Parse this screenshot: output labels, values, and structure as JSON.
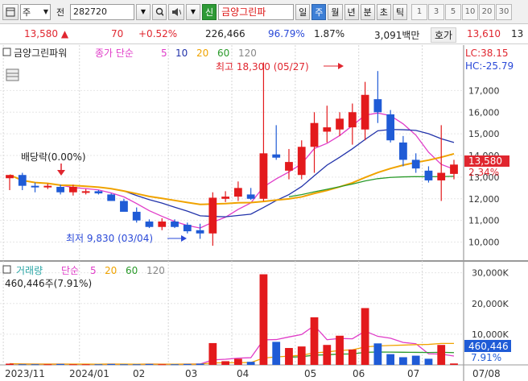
{
  "toolbar": {
    "layout_icon": "window-icon",
    "type_value": "주",
    "field_label": "전",
    "code": "282720",
    "sound_icon": "speaker-icon",
    "credit_label": "신",
    "stock_name": "금양그린파",
    "periods": [
      "일",
      "주",
      "월",
      "년",
      "분",
      "초",
      "틱"
    ],
    "active_period": "주",
    "intervals": [
      "1",
      "3",
      "5",
      "10",
      "20",
      "30"
    ]
  },
  "info": {
    "price": "13,580",
    "change": "70",
    "change_pct": "+0.52%",
    "volume": "226,466",
    "vol_ratio": "96.79%",
    "turnover": "1.87%",
    "amount": "3,091백만",
    "ask_label": "호가",
    "ask_price": "13,610",
    "last": "13"
  },
  "price_panel": {
    "title": "금양그린파워",
    "ma_label": "종가 단순",
    "ma_periods": [
      "5",
      "10",
      "20",
      "60",
      "120"
    ],
    "lc": "LC:38.15",
    "hc": "HC:-25.79",
    "high_note": "최고 18,300 (05/27)",
    "low_note": "최저 9,830 (03/04)",
    "dividend_note": "배당락(0.00%)",
    "current_price": "13,580",
    "current_pct": "2.34%",
    "y_ticks": [
      "17,000",
      "16,000",
      "15,000",
      "14,000",
      "13,000",
      "12,000",
      "11,000",
      "10,000"
    ]
  },
  "volume_panel": {
    "title": "거래량",
    "ma_label": "단순",
    "ma_periods": [
      "5",
      "20",
      "60",
      "120"
    ],
    "volume_note": "460,446주(7.91%)",
    "current_volume": "460,446",
    "current_pct": "7.91%",
    "y_ticks": [
      "30,000K",
      "20,000K",
      "10,000K"
    ]
  },
  "x_axis": [
    "2023/11",
    "2024/01",
    "02",
    "03",
    "04",
    "05",
    "06",
    "07",
    "07/08"
  ],
  "colors": {
    "up": "#e31a1c",
    "down": "#1f5bd6",
    "ma5": "#e03cc8",
    "ma10": "#2233aa",
    "ma20": "#f0a300",
    "ma60": "#2a9a2a"
  },
  "chart_data": {
    "type": "candlestick",
    "candles": [
      {
        "o": 12950,
        "h": 13100,
        "l": 12400,
        "c": 13100
      },
      {
        "o": 13100,
        "h": 13200,
        "l": 12400,
        "c": 12600
      },
      {
        "o": 12600,
        "h": 12750,
        "l": 12300,
        "c": 12550
      },
      {
        "o": 12550,
        "h": 12700,
        "l": 12450,
        "c": 12600
      },
      {
        "o": 12550,
        "h": 12650,
        "l": 12200,
        "c": 12300
      },
      {
        "o": 12300,
        "h": 12650,
        "l": 12150,
        "c": 12550
      },
      {
        "o": 12300,
        "h": 12450,
        "l": 12200,
        "c": 12350
      },
      {
        "o": 12350,
        "h": 12400,
        "l": 12200,
        "c": 12250
      },
      {
        "o": 12200,
        "h": 12250,
        "l": 11900,
        "c": 11900
      },
      {
        "o": 11900,
        "h": 12000,
        "l": 11500,
        "c": 11400
      },
      {
        "o": 11400,
        "h": 11600,
        "l": 10900,
        "c": 11000
      },
      {
        "o": 10950,
        "h": 11050,
        "l": 10650,
        "c": 10700
      },
      {
        "o": 10700,
        "h": 11100,
        "l": 10550,
        "c": 10950
      },
      {
        "o": 10950,
        "h": 11050,
        "l": 10650,
        "c": 10700
      },
      {
        "o": 10800,
        "h": 10900,
        "l": 10400,
        "c": 10500
      },
      {
        "o": 10550,
        "h": 10850,
        "l": 10150,
        "c": 10400
      },
      {
        "o": 10400,
        "h": 12300,
        "l": 9830,
        "c": 12050
      },
      {
        "o": 12000,
        "h": 12350,
        "l": 11850,
        "c": 12100
      },
      {
        "o": 12100,
        "h": 12800,
        "l": 11900,
        "c": 12500
      },
      {
        "o": 12200,
        "h": 12500,
        "l": 11950,
        "c": 12000
      },
      {
        "o": 12000,
        "h": 18300,
        "l": 11900,
        "c": 14100
      },
      {
        "o": 14050,
        "h": 15400,
        "l": 13800,
        "c": 13900
      },
      {
        "o": 13300,
        "h": 14300,
        "l": 12900,
        "c": 13700
      },
      {
        "o": 13100,
        "h": 14700,
        "l": 12900,
        "c": 14400
      },
      {
        "o": 14400,
        "h": 16000,
        "l": 13200,
        "c": 15500
      },
      {
        "o": 15100,
        "h": 16300,
        "l": 14600,
        "c": 15300
      },
      {
        "o": 15200,
        "h": 16000,
        "l": 14900,
        "c": 15700
      },
      {
        "o": 15300,
        "h": 16400,
        "l": 14500,
        "c": 16000
      },
      {
        "o": 15200,
        "h": 17400,
        "l": 14700,
        "c": 16800
      },
      {
        "o": 16600,
        "h": 17900,
        "l": 15500,
        "c": 16000
      },
      {
        "o": 15900,
        "h": 16100,
        "l": 14600,
        "c": 14700
      },
      {
        "o": 14600,
        "h": 14900,
        "l": 13500,
        "c": 13800
      },
      {
        "o": 13800,
        "h": 14100,
        "l": 13200,
        "c": 13400
      },
      {
        "o": 13300,
        "h": 13500,
        "l": 12750,
        "c": 12850
      },
      {
        "o": 12850,
        "h": 15400,
        "l": 11900,
        "c": 13200
      },
      {
        "o": 13150,
        "h": 13800,
        "l": 12900,
        "c": 13580
      }
    ],
    "volumes": [
      0.4,
      0.2,
      0.2,
      0.2,
      0.3,
      0.2,
      0.2,
      0.2,
      0.3,
      0.2,
      0.2,
      0.3,
      0.2,
      0.2,
      0.3,
      0.4,
      7.1,
      1.2,
      2.0,
      1.0,
      29.5,
      7.5,
      5.5,
      6.0,
      15.5,
      6.5,
      9.5,
      5.0,
      18.5,
      7.0,
      3.5,
      2.5,
      3.0,
      2.0,
      6.5,
      0.46
    ],
    "y_range": [
      9500,
      18800
    ],
    "vol_range": [
      0,
      32
    ],
    "grid": true
  }
}
